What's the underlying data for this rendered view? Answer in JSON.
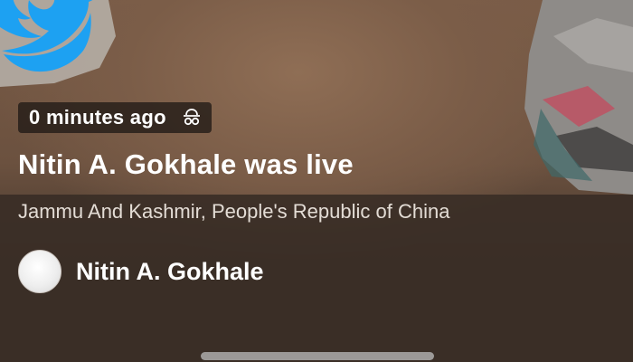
{
  "card": {
    "time_ago": "0 minutes ago",
    "title": "Nitin A. Gokhale was live",
    "location": "Jammu And Kashmir, People's Republic of China",
    "author_name": "Nitin A. Gokhale"
  },
  "icons": {
    "brand": "twitter-bird-icon",
    "time_badge": "incognito-icon",
    "avatar": "default-avatar"
  },
  "colors": {
    "brand_blue": "#1da1f2",
    "text_primary": "#ffffff",
    "text_secondary": "#e3dcd5",
    "scrim": "#3a2e26"
  }
}
